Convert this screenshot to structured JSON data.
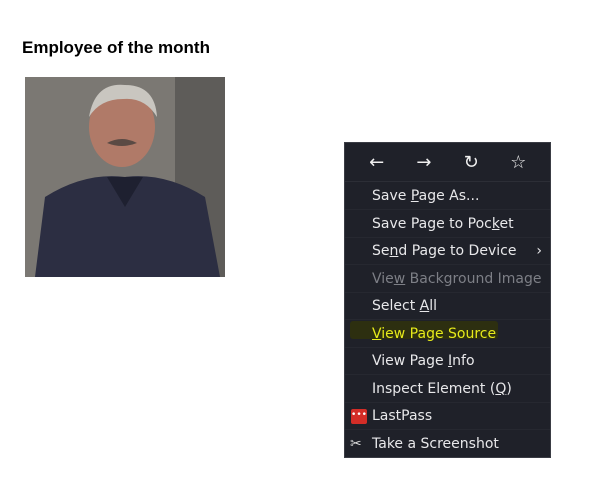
{
  "page": {
    "title": "Employee of the month"
  },
  "menu": {
    "nav": {
      "back": "←",
      "forward": "→",
      "reload": "↻",
      "bookmark": "☆"
    },
    "items": [
      {
        "pre": "Save ",
        "u": "P",
        "post": "age As..."
      },
      {
        "pre": "Save Page to Poc",
        "u": "k",
        "post": "et"
      },
      {
        "pre": "Se",
        "u": "n",
        "post": "d Page to Device",
        "submenu": "›"
      },
      {
        "pre": "Vie",
        "u": "w",
        "post": " Background Image",
        "disabled": true
      },
      {
        "pre": "Select ",
        "u": "A",
        "post": "ll"
      },
      {
        "pre": "",
        "u": "V",
        "post": "iew Page Source",
        "highlighted": true
      },
      {
        "pre": "View Page ",
        "u": "I",
        "post": "nfo"
      },
      {
        "pre": "Inspect Element (",
        "u": "Q",
        "post": ")"
      },
      {
        "pre": "LastPass",
        "u": "",
        "post": "",
        "icon": "•••"
      },
      {
        "pre": "Take a Screenshot",
        "u": "",
        "post": "",
        "icon": "✂"
      }
    ],
    "highlight_color": "#e6ea1a"
  }
}
